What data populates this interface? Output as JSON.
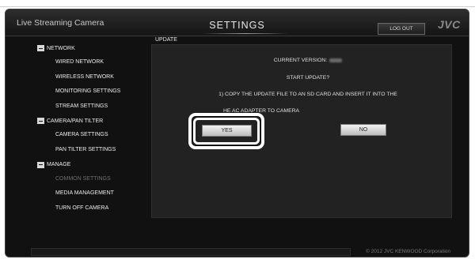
{
  "app": {
    "title": "Live Streaming Camera",
    "page_title": "SETTINGS",
    "logout_label": "LOG OUT",
    "brand": "JVC"
  },
  "sidebar": {
    "groups": [
      {
        "label": "NETWORK",
        "items": [
          "WIRED NETWORK",
          "WIRELESS NETWORK",
          "MONITORING SETTINGS",
          "STREAM SETTINGS"
        ]
      },
      {
        "label": "CAMERA/PAN TILTER",
        "items": [
          "CAMERA SETTINGS",
          "PAN TILTER SETTINGS"
        ]
      },
      {
        "label": "MANAGE",
        "items": [
          "COMMON SETTINGS",
          "MEDIA MANAGEMENT",
          "TURN OFF CAMERA"
        ]
      }
    ],
    "disabled_item": "COMMON SETTINGS"
  },
  "main": {
    "section_label": "UPDATE",
    "current_version_label": "CURRENT VERSION:",
    "start_update": "START UPDATE?",
    "step1": "1) COPY THE UPDATE FILE TO AN SD CARD AND INSERT IT INTO THE",
    "step2": "HE AC ADAPTER TO CAMERA",
    "yes_label": "YES",
    "no_label": "NO"
  },
  "footer": {
    "copyright": "© 2012 JVC KENWOOD Corporation"
  },
  "colors": {
    "background": "#111111",
    "panel": "#222222",
    "text": "#eaeaea",
    "disabled": "#6e6e6e"
  }
}
